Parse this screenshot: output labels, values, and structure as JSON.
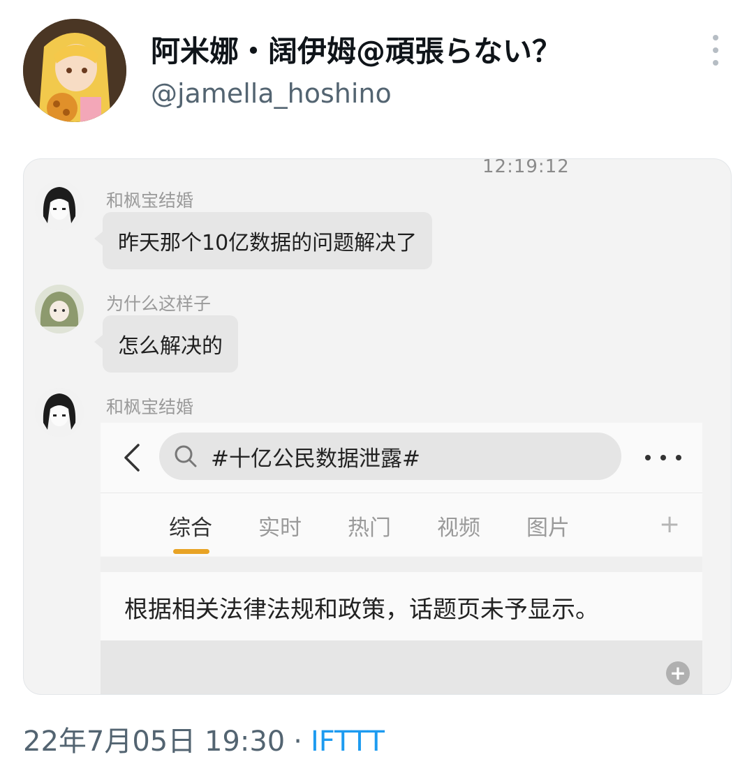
{
  "tweet": {
    "display_name": "阿米娜・阔伊姆@頑張らない？",
    "handle": "@jamella_hoshino",
    "date": "22年7月05日 19:30",
    "separator": "·",
    "source": "IFTTT"
  },
  "media": {
    "timestamp": "12:19:12",
    "messages": [
      {
        "sender": "和枫宝结婚",
        "text": "昨天那个10亿数据的问题解决了"
      },
      {
        "sender": "为什么这样子",
        "text": "怎么解决的"
      },
      {
        "sender": "和枫宝结婚"
      }
    ],
    "inner_screenshot": {
      "search_query": "#十亿公民数据泄露#",
      "tabs": [
        "综合",
        "实时",
        "热门",
        "视频",
        "图片"
      ],
      "active_tab": "综合",
      "add_tab_symbol": "+",
      "notice": "根据相关法律法规和政策，话题页未予显示。"
    }
  },
  "colors": {
    "link": "#1d9bf0",
    "secondary_text": "#536471",
    "tab_underline": "#e8a325",
    "bubble": "#e6e6e6"
  }
}
